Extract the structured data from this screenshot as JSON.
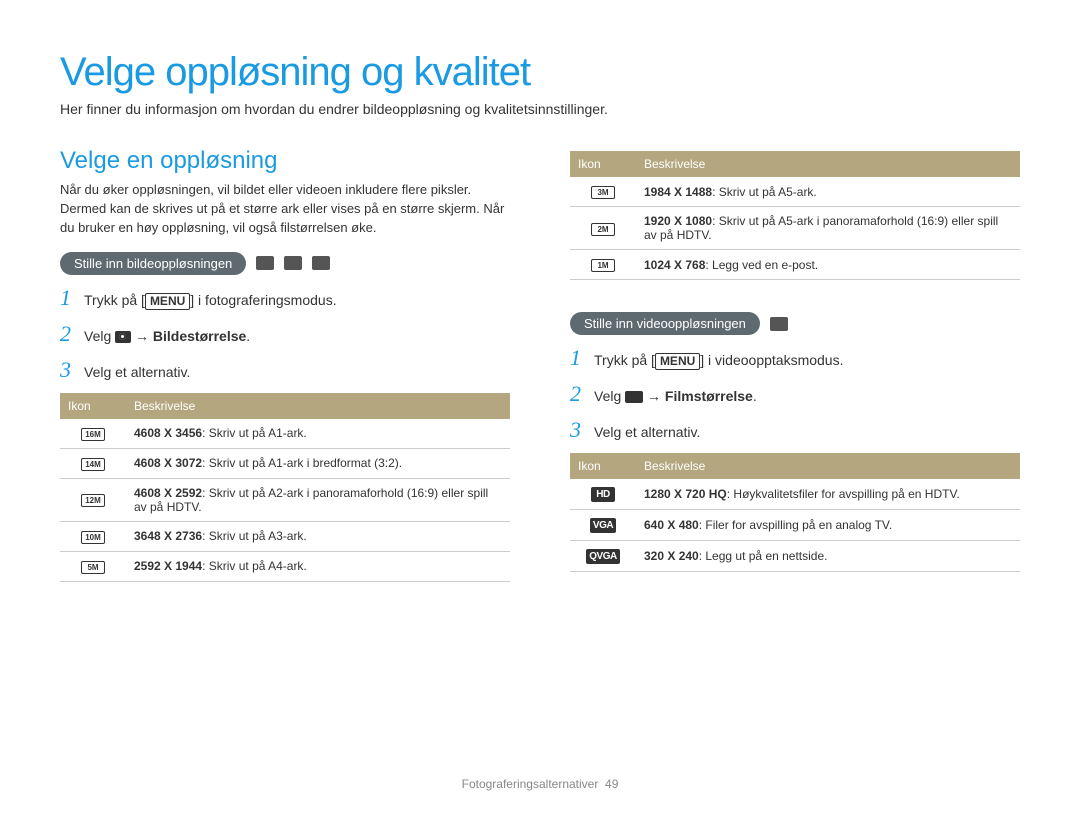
{
  "title": "Velge oppløsning og kvalitet",
  "intro": "Her finner du informasjon om hvordan du endrer bildeoppløsning og kvalitetsinnstillinger.",
  "section_heading": "Velge en oppløsning",
  "section_body": "Når du øker oppløsningen, vil bildet eller videoen inkludere flere piksler. Dermed kan de skrives ut på et større ark eller vises på en større skjerm. Når du bruker en høy oppløsning, vil også filstørrelsen øke.",
  "photo": {
    "pill": "Stille inn bildeoppløsningen",
    "step1_pre": "Trykk på [",
    "step1_kbd": "MENU",
    "step1_post": "] i fotograferingsmodus.",
    "step2_pre": "Velg ",
    "step2_arrow": " → ",
    "step2_bold": "Bildestørrelse",
    "step3": "Velg et alternativ.",
    "th_icon": "Ikon",
    "th_desc": "Beskrivelse",
    "rows": [
      {
        "icon": "16M",
        "bold": "4608 X 3456",
        "rest": ": Skriv ut på A1-ark."
      },
      {
        "icon": "14M",
        "bold": "4608 X 3072",
        "rest": ": Skriv ut på A1-ark i bredformat (3:2)."
      },
      {
        "icon": "12M",
        "bold": "4608 X 2592",
        "rest": ": Skriv ut på A2-ark i panoramaforhold (16:9) eller spill av på HDTV."
      },
      {
        "icon": "10M",
        "bold": "3648 X 2736",
        "rest": ": Skriv ut på A3-ark."
      },
      {
        "icon": "5M",
        "bold": "2592 X 1944",
        "rest": ": Skriv ut på A4-ark."
      }
    ],
    "cont_rows": [
      {
        "icon": "3M",
        "bold": "1984 X 1488",
        "rest": ": Skriv ut på A5-ark."
      },
      {
        "icon": "2M",
        "bold": "1920 X 1080",
        "rest": ": Skriv ut på A5-ark i panoramaforhold (16:9) eller spill av på HDTV."
      },
      {
        "icon": "1M",
        "bold": "1024 X 768",
        "rest": ": Legg ved en e-post."
      }
    ]
  },
  "video": {
    "pill": "Stille inn videooppløsningen",
    "step1_pre": "Trykk på [",
    "step1_kbd": "MENU",
    "step1_post": "] i videoopptaksmodus.",
    "step2_pre": "Velg ",
    "step2_arrow": " → ",
    "step2_bold": "Filmstørrelse",
    "step3": "Velg et alternativ.",
    "th_icon": "Ikon",
    "th_desc": "Beskrivelse",
    "rows": [
      {
        "icon": "HD",
        "bold": "1280 X 720 HQ",
        "rest": ": Høykvalitetsfiler for avspilling på en HDTV."
      },
      {
        "icon": "VGA",
        "bold": "640 X 480",
        "rest": ": Filer for avspilling på en analog TV."
      },
      {
        "icon": "QVGA",
        "bold": "320 X 240",
        "rest": ": Legg ut på en nettside."
      }
    ]
  },
  "footer_section": "Fotograferingsalternativer",
  "footer_page": "49"
}
